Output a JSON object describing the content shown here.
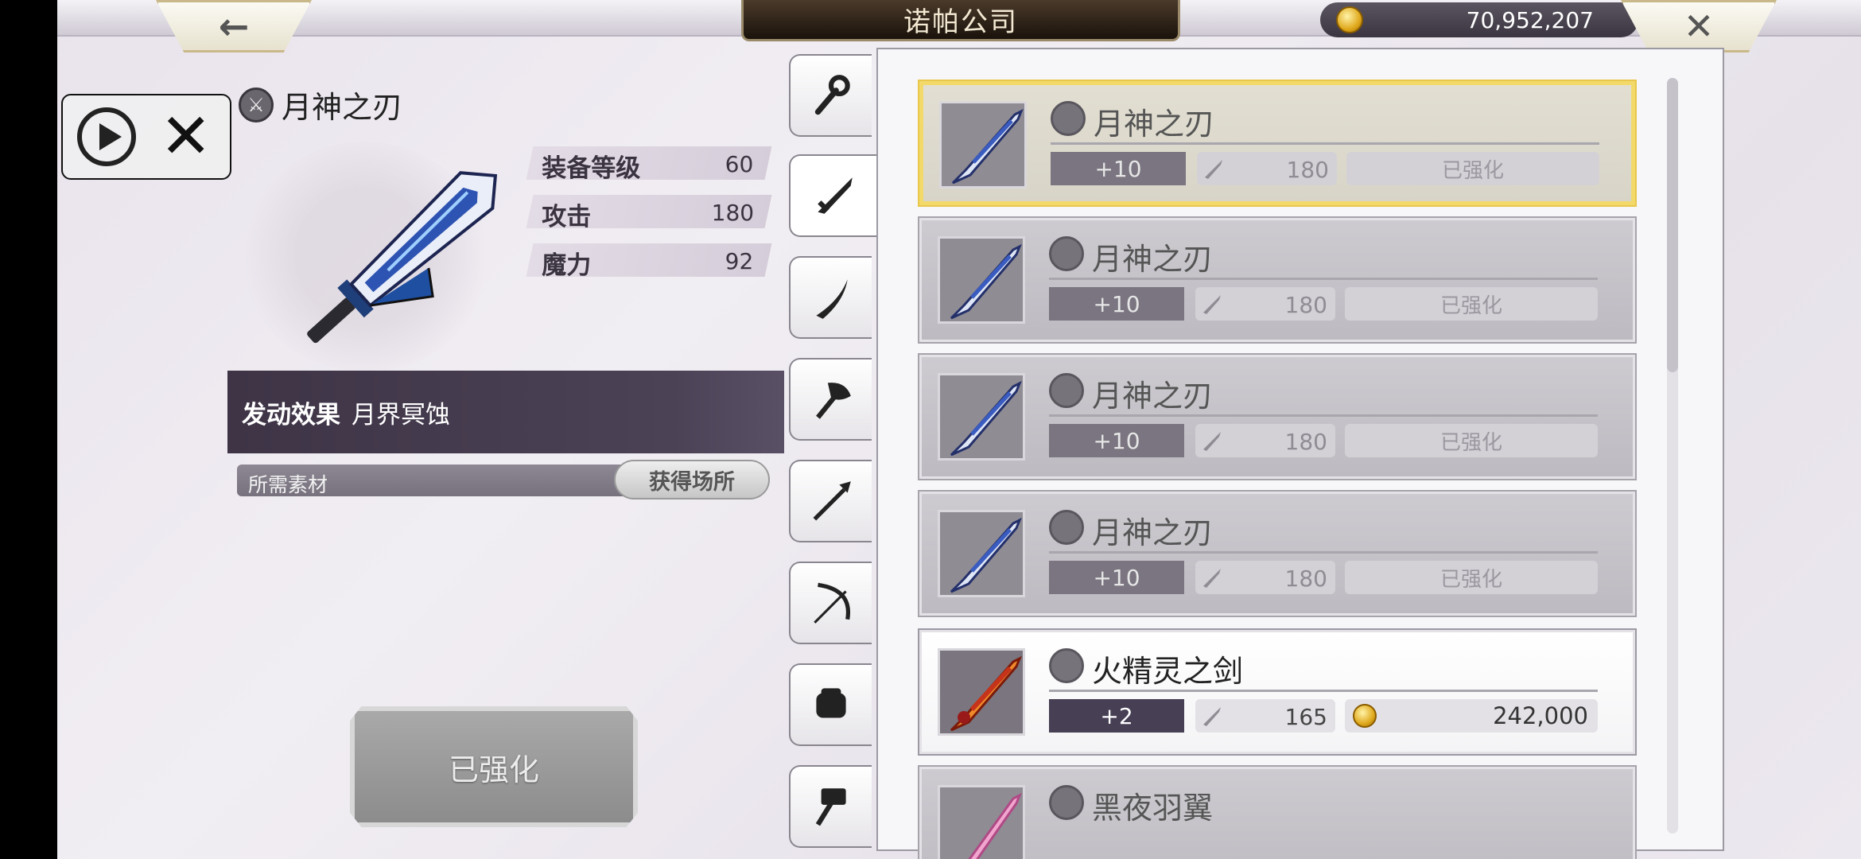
{
  "header": {
    "back_icon": "left-arrow-icon",
    "title": "诺帕公司",
    "gold": "70,952,207",
    "close_icon": "close-icon"
  },
  "overlay": {
    "play_icon": "play-circle-icon",
    "close_icon": "x-icon"
  },
  "selected_item": {
    "name": "月神之刃",
    "stats": [
      {
        "label": "装备等级",
        "value": "60"
      },
      {
        "label": "攻击",
        "value": "180"
      },
      {
        "label": "魔力",
        "value": "92"
      }
    ],
    "effect_label": "发动效果",
    "effect_value": "月界冥蚀",
    "material_label": "所需素材",
    "source_button": "获得场所",
    "action_button": "已强化"
  },
  "tabs": [
    {
      "name": "staff",
      "icon": "staff-icon"
    },
    {
      "name": "sword",
      "icon": "sword-icon",
      "active": true
    },
    {
      "name": "katana",
      "icon": "curved-blade-icon"
    },
    {
      "name": "axe",
      "icon": "axe-icon"
    },
    {
      "name": "spear",
      "icon": "spear-icon"
    },
    {
      "name": "bow",
      "icon": "bow-icon"
    },
    {
      "name": "fist",
      "icon": "gauntlet-icon"
    },
    {
      "name": "hammer",
      "icon": "hammer-icon"
    }
  ],
  "items": [
    {
      "name": "月神之刃",
      "level": "+10",
      "attack": "180",
      "status": "已强化",
      "state": "selected",
      "weapon_color": "#3a4f9f"
    },
    {
      "name": "月神之刃",
      "level": "+10",
      "attack": "180",
      "status": "已强化",
      "state": "owned",
      "weapon_color": "#3a4f9f"
    },
    {
      "name": "月神之刃",
      "level": "+10",
      "attack": "180",
      "status": "已强化",
      "state": "owned",
      "weapon_color": "#3a4f9f"
    },
    {
      "name": "月神之刃",
      "level": "+10",
      "attack": "180",
      "status": "已强化",
      "state": "owned",
      "weapon_color": "#3a4f9f"
    },
    {
      "name": "火精灵之剑",
      "level": "+2",
      "attack": "165",
      "status": "242,000",
      "state": "purchasable",
      "weapon_color": "#c5331a"
    },
    {
      "name": "黑夜羽翼",
      "state": "owned",
      "weapon_color": "#d86aa8"
    }
  ]
}
